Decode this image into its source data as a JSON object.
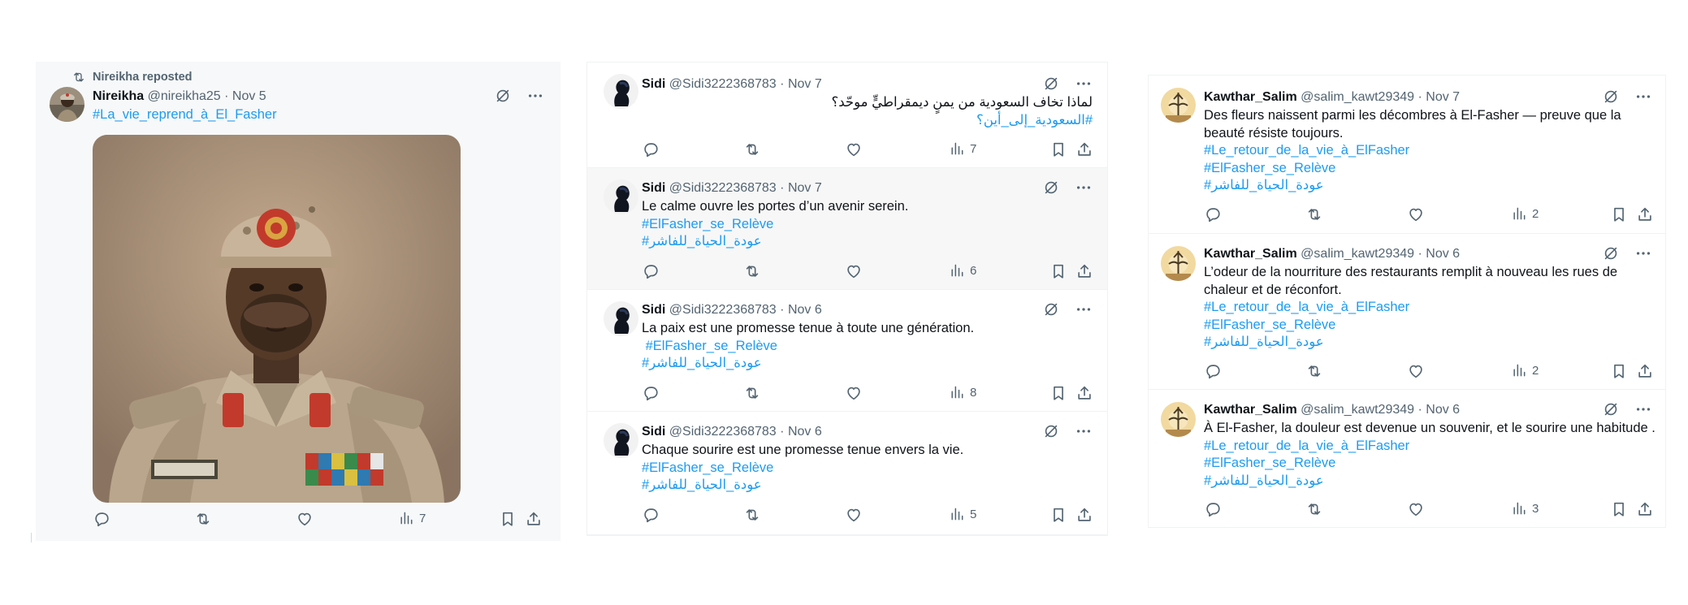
{
  "colors": {
    "link": "#1d9bf0",
    "muted": "#536471",
    "text": "#0f1419"
  },
  "panel1": {
    "repost_label": "Nireikha reposted",
    "tweet": {
      "name": "Nireikha",
      "handle": "@nireikha25",
      "date": "Nov 5",
      "hashtag": "#La_vie_reprend_à_El_Fasher",
      "views": "7"
    }
  },
  "panel2": {
    "tweets": [
      {
        "name": "Sidi",
        "handle": "@Sidi3222368783",
        "date": "Nov 7",
        "lines": [
          "لماذا تخاف السعودية من يمنٍ ديمقراطيٍّ موحّد؟"
        ],
        "tags": [
          "#السعودية_إلى_أين؟"
        ],
        "views": "7"
      },
      {
        "name": "Sidi",
        "handle": "@Sidi3222368783",
        "date": "Nov 7",
        "lines": [
          "Le calme ouvre les portes d’un avenir serein."
        ],
        "tags": [
          "#ElFasher_se_Relève",
          "#عودة_الحياة_للفاشر"
        ],
        "views": "6"
      },
      {
        "name": "Sidi",
        "handle": "@Sidi3222368783",
        "date": "Nov 6",
        "lines": [
          "La paix est une promesse tenue à toute une génération."
        ],
        "tags": [
          " #ElFasher_se_Relève",
          "#عودة_الحياة_للفاشر"
        ],
        "views": "8"
      },
      {
        "name": "Sidi",
        "handle": "@Sidi3222368783",
        "date": "Nov 6",
        "lines": [
          "Chaque sourire est une promesse tenue envers la vie."
        ],
        "tags": [
          "#ElFasher_se_Relève",
          "#عودة_الحياة_للفاشر"
        ],
        "views": "5"
      }
    ]
  },
  "panel3": {
    "tweets": [
      {
        "name": "Kawthar_Salim",
        "handle": "@salim_kawt29349",
        "date": "Nov 7",
        "lines": [
          "Des fleurs naissent parmi les décombres à El-Fasher — preuve que la",
          "beauté résiste toujours."
        ],
        "tags": [
          "#Le_retour_de_la_vie_à_ElFasher",
          "#ElFasher_se_Relève",
          "#عودة_الحياة_للفاشر"
        ],
        "views": "2"
      },
      {
        "name": "Kawthar_Salim",
        "handle": "@salim_kawt29349",
        "date": "Nov 6",
        "lines": [
          "L’odeur de la nourriture des restaurants remplit à nouveau les rues de",
          "chaleur et de réconfort."
        ],
        "tags": [
          "#Le_retour_de_la_vie_à_ElFasher",
          "#ElFasher_se_Relève",
          "#عودة_الحياة_للفاشر"
        ],
        "views": "2"
      },
      {
        "name": "Kawthar_Salim",
        "handle": "@salim_kawt29349",
        "date": "Nov 6",
        "lines": [
          "À El-Fasher, la douleur est devenue un souvenir, et le sourire une habitude ."
        ],
        "tags": [
          "#Le_retour_de_la_vie_à_ElFasher",
          "#ElFasher_se_Relève",
          "#عودة_الحياة_للفاشر"
        ],
        "views": "3"
      }
    ]
  }
}
